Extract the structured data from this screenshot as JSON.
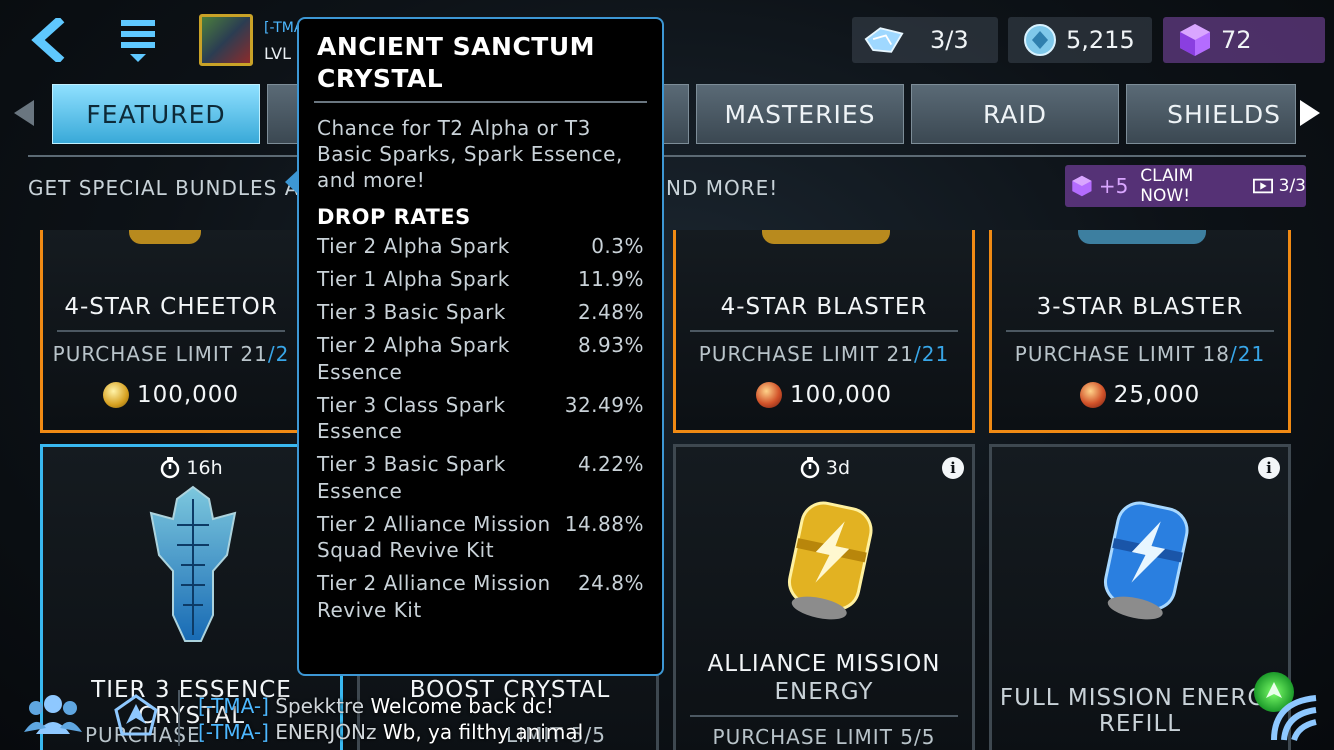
{
  "header": {
    "player_tag": "[-TMA",
    "player_level": "LVL",
    "currencies": [
      {
        "icon": "energy-shard-icon",
        "value": "3/3"
      },
      {
        "icon": "crystal-coin-icon",
        "value": "5,215"
      },
      {
        "icon": "gem-cube-icon",
        "value": "72"
      }
    ]
  },
  "tabs": [
    {
      "label": "FEATURED",
      "active": true
    },
    {
      "label": "",
      "active": false
    },
    {
      "label": "",
      "active": false
    },
    {
      "label": "MASTERIES",
      "active": false
    },
    {
      "label": "RAID",
      "active": false
    },
    {
      "label": "SHIELDS",
      "active": false
    }
  ],
  "banner": {
    "subtitle_left": "GET SPECIAL BUNDLES AND",
    "subtitle_right": "ND MORE!",
    "claim_plus": "+5",
    "claim_label": "CLAIM NOW!",
    "claim_count": "3/3"
  },
  "cards_top": [
    {
      "title": "4-STAR CHEETOR",
      "limit_used": "PURCHASE LIMIT 21",
      "limit_max": "/2",
      "price": "100,000",
      "coin": "gold"
    },
    {
      "title": "4-STAR BLASTER",
      "limit_used": "PURCHASE LIMIT 21",
      "limit_max": "/21",
      "price": "100,000",
      "coin": "red"
    },
    {
      "title": "3-STAR BLASTER",
      "limit_used": "PURCHASE LIMIT 18",
      "limit_max": "/21",
      "price": "25,000",
      "coin": "red"
    }
  ],
  "cards_bottom": [
    {
      "timer": "16h",
      "title": "TIER 3 ESSENCE CRYSTAL",
      "limit": "PURCHASE"
    },
    {
      "title": "BOOST CRYSTAL",
      "limit": "LIMIT 5/5"
    },
    {
      "timer": "3d",
      "title": "ALLIANCE MISSION",
      "title2": "ENERGY",
      "limit": "PURCHASE LIMIT 5/5"
    },
    {
      "title": "FULL MISSION ENERGY",
      "title2": "REFILL"
    }
  ],
  "chat": [
    {
      "tag": "[-TMA-]",
      "name": "Spekktre",
      "message": "Welcome back dc!"
    },
    {
      "tag": "[-TMA-]",
      "name": "ENERJONz",
      "message": "Wb, ya filthy animal"
    }
  ],
  "tooltip": {
    "title": "ANCIENT SANCTUM CRYSTAL",
    "description": "Chance for T2 Alpha or T3 Basic Sparks, Spark Essence, and more!",
    "drop_rates_heading": "DROP RATES",
    "rates": [
      {
        "name": "Tier 2 Alpha Spark",
        "pct": "0.3%"
      },
      {
        "name": "Tier 1 Alpha Spark",
        "pct": "11.9%"
      },
      {
        "name": "Tier 3 Basic Spark",
        "pct": "2.48%"
      },
      {
        "name": "Tier 2 Alpha Spark Essence",
        "pct": "8.93%"
      },
      {
        "name": "Tier 3 Class Spark Essence",
        "pct": "32.49%"
      },
      {
        "name": "Tier 3 Basic Spark Essence",
        "pct": "4.22%"
      },
      {
        "name": "Tier 2 Alliance Mission Squad Revive Kit",
        "pct": "14.88%"
      },
      {
        "name": "Tier 2 Alliance Mission Revive Kit",
        "pct": "24.8%"
      }
    ]
  },
  "colors": {
    "accent_blue": "#39b8f0",
    "card_orange": "#f08a14",
    "gem_purple": "#8c4fd0"
  }
}
